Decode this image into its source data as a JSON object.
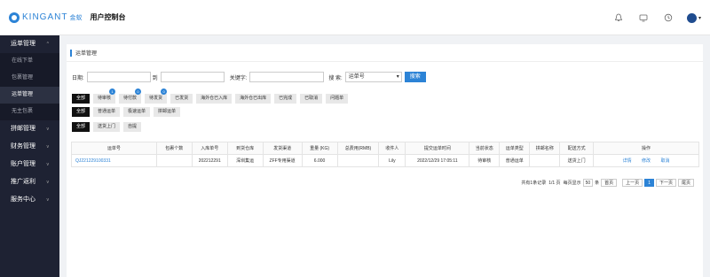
{
  "header": {
    "logo_text": "KINGANT",
    "logo_sub": "金蚁",
    "console_title": "用户控制台"
  },
  "sidebar": {
    "groups": [
      {
        "label": "运单管理",
        "items": [
          "在线下单",
          "包裹管理",
          "运单管理",
          "无主包裹"
        ]
      },
      {
        "label": "拼邮管理"
      },
      {
        "label": "财务管理"
      },
      {
        "label": "账户管理"
      },
      {
        "label": "推广返利"
      },
      {
        "label": "服务中心"
      }
    ],
    "active_item": "运单管理"
  },
  "main": {
    "title": "运单管理",
    "filter": {
      "date_label": "日期:",
      "to_label": "到",
      "keyword_label": "关键字:",
      "search_label": "搜 索:",
      "search_field": "运单号",
      "search_button": "搜索"
    },
    "status_tabs": [
      {
        "label": "全部"
      },
      {
        "label": "待审核",
        "badge": "1"
      },
      {
        "label": "待付款",
        "badge": "0"
      },
      {
        "label": "待发货",
        "badge": "0"
      },
      {
        "label": "已发货"
      },
      {
        "label": "海外仓已入库"
      },
      {
        "label": "海外仓已出库"
      },
      {
        "label": "已完成"
      },
      {
        "label": "已取消"
      },
      {
        "label": "问题单"
      }
    ],
    "type_tabs": [
      "全部",
      "普通运单",
      "极速运单",
      "拼邮运单"
    ],
    "delivery_tabs": [
      "全部",
      "送货上门",
      "自提"
    ],
    "table": {
      "columns": [
        "运单号",
        "包裹个数",
        "入库单号",
        "到货仓库",
        "发货渠道",
        "重量 (KG)",
        "总费用(RMB)",
        "收件人",
        "提交运单时间",
        "当前状态",
        "运单类型",
        "拼邮名称",
        "配送方式",
        "操作"
      ],
      "rows": [
        {
          "order_no": "QJ221229100331",
          "package_count": "",
          "inbound_no": "202212291",
          "warehouse": "深圳集运",
          "channel": "ZFF专用渠道",
          "weight": "6.000",
          "total_fee": "",
          "recipient": "Lily",
          "submit_time": "2022/12/29 17:05:11",
          "status": "待审核",
          "type": "普通运单",
          "group_name": "",
          "delivery": "送货上门",
          "ops": [
            "详情",
            "修改",
            "取消"
          ]
        }
      ]
    },
    "pager": {
      "summary": "共有1条记录",
      "page_info": "1/1 页",
      "per_page_label": "每页显示",
      "per_page": "50",
      "per_page_unit": "条",
      "first": "首页",
      "prev": "上一页",
      "current": "1",
      "next": "下一页",
      "last": "尾页"
    }
  }
}
